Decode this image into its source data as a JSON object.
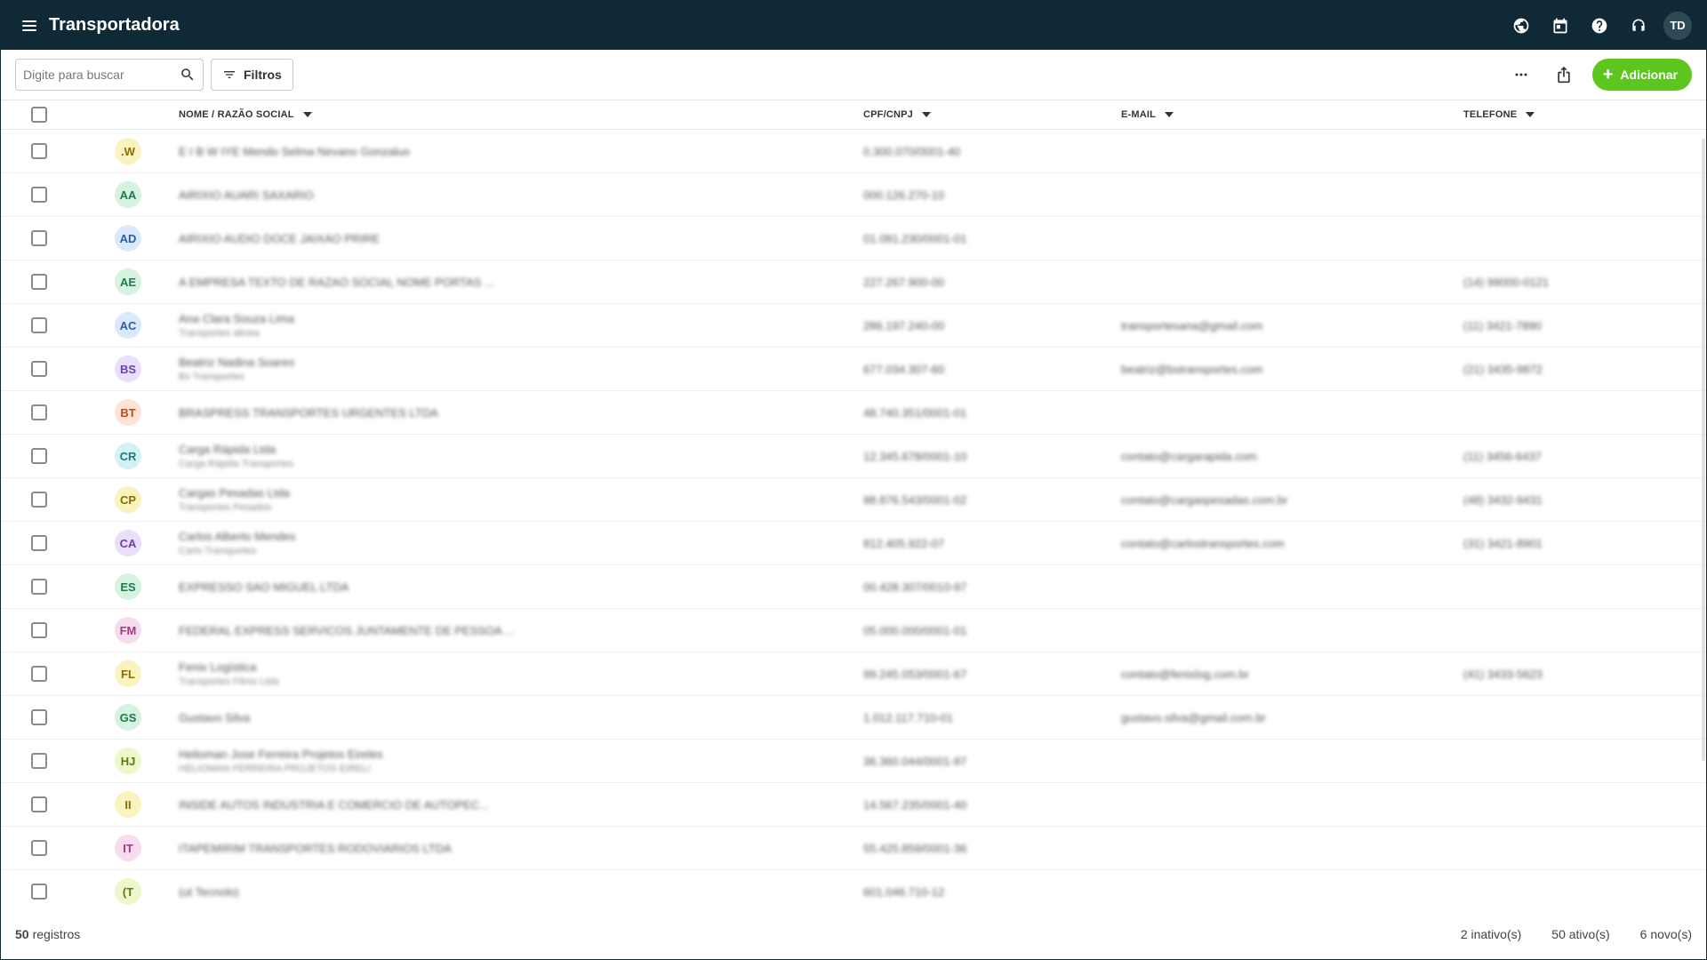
{
  "header": {
    "title": "Transportadora",
    "user_initials": "TD"
  },
  "toolbar": {
    "search_placeholder": "Digite para buscar",
    "filter_label": "Filtros",
    "add_label": "Adicionar"
  },
  "columns": {
    "name": "NOME / RAZÃO SOCIAL",
    "doc": "CPF/CNPJ",
    "email": "E-MAIL",
    "phone": "TELEFONE"
  },
  "colors": {
    "topbar": "#0f2a36",
    "accent": "#5cc61e"
  },
  "rows": [
    {
      "initials": ".W",
      "bg": "#fbf3bf",
      "fg": "#8a6d00",
      "name": "E I B W IYE Mendo Selma Nevano Gonzaluo",
      "sub": "",
      "doc": "0.300.070/0001-40",
      "email": "",
      "phone": ""
    },
    {
      "initials": "AA",
      "bg": "#d6f2e1",
      "fg": "#1f7a4a",
      "name": "AIRIXIO AUARI SAXARIO",
      "sub": "",
      "doc": "000.126.270-10",
      "email": "",
      "phone": ""
    },
    {
      "initials": "AD",
      "bg": "#dbe9fb",
      "fg": "#2a5fa8",
      "name": "AIRIXIO AUDIO DOCE JAIXAO PRIRE",
      "sub": "",
      "doc": "01.091.230/0001-01",
      "email": "",
      "phone": ""
    },
    {
      "initials": "AE",
      "bg": "#d6f2e1",
      "fg": "#1f7a4a",
      "name": "A EMPRESA TEXTO DE RAZAO SOCIAL NOME PORTAS ...",
      "sub": "",
      "doc": "227.267.900-00",
      "email": "",
      "phone": "(14) 99000-0121"
    },
    {
      "initials": "AC",
      "bg": "#dbe9fb",
      "fg": "#2a5fa8",
      "name": "Ana Clara Souza Lima",
      "sub": "Transportes alinea",
      "doc": "286.197.240-00",
      "email": "transportesana@gmail.com",
      "phone": "(11) 3421-7890"
    },
    {
      "initials": "BS",
      "bg": "#eadffa",
      "fg": "#6b3fb0",
      "name": "Beatriz Nadina Soares",
      "sub": "Bs Transportes",
      "doc": "677.034.307-60",
      "email": "beatriz@bstransportes.com",
      "phone": "(21) 3435-9872"
    },
    {
      "initials": "BT",
      "bg": "#fde3d6",
      "fg": "#b0501f",
      "name": "BRASPRESS TRANSPORTES URGENTES LTDA",
      "sub": "",
      "doc": "48.740.351/0001-01",
      "email": "",
      "phone": ""
    },
    {
      "initials": "CR",
      "bg": "#d4f1f4",
      "fg": "#1d7a86",
      "name": "Carga Rápida Ltda",
      "sub": "Carga Rápida Transportes",
      "doc": "12.345.678/0001-10",
      "email": "contato@cargarapida.com",
      "phone": "(11) 3456-6437"
    },
    {
      "initials": "CP",
      "bg": "#fbf3bf",
      "fg": "#8a6d00",
      "name": "Cargas Pesadas Ltda",
      "sub": "Transportes Pesados",
      "doc": "98.876.543/0001-02",
      "email": "contato@cargaspesadas.com.br",
      "phone": "(48) 3432-9431"
    },
    {
      "initials": "CA",
      "bg": "#eadffa",
      "fg": "#6b3fb0",
      "name": "Carlos Alberto Mendes",
      "sub": "Carlo Transportes",
      "doc": "812.405.922-07",
      "email": "contato@carlostransportes.com",
      "phone": "(31) 3421-8901"
    },
    {
      "initials": "ES",
      "bg": "#d6f2e1",
      "fg": "#1f7a4a",
      "name": "EXPRESSO SAO MIGUEL LTDA",
      "sub": "",
      "doc": "00.428.307/0010-97",
      "email": "",
      "phone": ""
    },
    {
      "initials": "FM",
      "bg": "#f6dcef",
      "fg": "#a03a83",
      "name": "FEDERAL EXPRESS SERVICOS JUNTAMENTE DE PESSOA ...",
      "sub": "",
      "doc": "05.000.000/0001-01",
      "email": "",
      "phone": ""
    },
    {
      "initials": "FL",
      "bg": "#fbf3bf",
      "fg": "#8a6d00",
      "name": "Fenix Logística",
      "sub": "Transportes Fênix Ltda",
      "doc": "99.245.053/0001-67",
      "email": "contato@fenixlog.com.br",
      "phone": "(41) 3433-5623"
    },
    {
      "initials": "GS",
      "bg": "#d6f2e1",
      "fg": "#1f7a4a",
      "name": "Gustavo Silva",
      "sub": "",
      "doc": "1.012.117.710-01",
      "email": "gustavo.silva@gmail.com.br",
      "phone": ""
    },
    {
      "initials": "HJ",
      "bg": "#eef7c9",
      "fg": "#5f7a11",
      "name": "Helioman Jose Ferreira Projetos Eireles",
      "sub": "HELIOMAN FERREIRA PROJETOS EIRELI",
      "doc": "36.360.044/0001-97",
      "email": "",
      "phone": ""
    },
    {
      "initials": "II",
      "bg": "#fbf3bf",
      "fg": "#8a6d00",
      "name": "INSIDE AUTOS INDUSTRIA E COMERCIO DE AUTOPEC...",
      "sub": "",
      "doc": "14.567.235/0001-40",
      "email": "",
      "phone": ""
    },
    {
      "initials": "IT",
      "bg": "#f6dcef",
      "fg": "#a03a83",
      "name": "ITAPEMIRIM TRANSPORTES RODOVIARIOS LTDA",
      "sub": "",
      "doc": "55.425.859/0001-36",
      "email": "",
      "phone": ""
    },
    {
      "initials": "(T",
      "bg": "#eef7c9",
      "fg": "#5f7a11",
      "name": "(ut Tecnolo)",
      "sub": "",
      "doc": "601.046.710-12",
      "email": "",
      "phone": ""
    }
  ],
  "footer": {
    "count": "50",
    "count_label": "registros",
    "inactive": "2 inativo(s)",
    "active": "50 ativo(s)",
    "new": "6 novo(s)"
  }
}
